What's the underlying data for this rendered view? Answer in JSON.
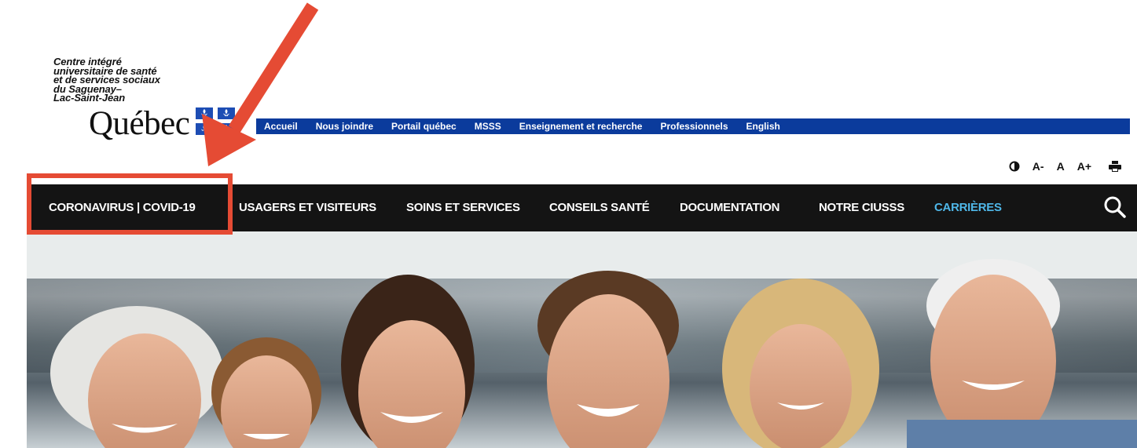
{
  "logo": {
    "org_name_lines": [
      "Centre intégré",
      "universitaire de santé",
      "et de services sociaux",
      "du Saguenay–",
      "Lac-Saint-Jean"
    ],
    "wordmark": "Québec",
    "flag_icon": "quebec-flag-icon",
    "colors": {
      "flag_blue": "#1d4db4"
    }
  },
  "top_links": [
    "Accueil",
    "Nous joindre",
    "Portail québec",
    "MSSS",
    "Enseignement et recherche",
    "Professionnels",
    "English"
  ],
  "accessibility_tools": {
    "contrast_icon": "contrast-icon",
    "font_smaller": "A-",
    "font_default": "A",
    "font_larger": "A+",
    "print_icon": "print-icon"
  },
  "main_nav": {
    "items": [
      {
        "label": "CORONAVIRUS | COVID-19"
      },
      {
        "label": "USAGERS ET VISITEURS"
      },
      {
        "label": "SOINS ET SERVICES"
      },
      {
        "label": "CONSEILS SANTÉ"
      },
      {
        "label": "DOCUMENTATION"
      },
      {
        "label": "NOTRE CIUSSS"
      },
      {
        "label": "CARRIÈRES"
      }
    ],
    "search_icon": "search-icon"
  },
  "colors": {
    "top_bar": "#0b3b9c",
    "nav_background": "#141414",
    "nav_accent": "#4fb7e8",
    "annotation": "#e54b34"
  },
  "annotations": {
    "arrow_icon": "arrow-pointer-icon",
    "highlight": "highlight-box"
  }
}
